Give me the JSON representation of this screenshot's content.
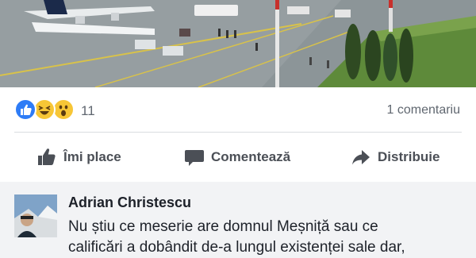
{
  "post": {
    "photo_alt": "airport apron with a turboprop aircraft"
  },
  "reactions": {
    "icons": [
      "like-icon",
      "haha-icon",
      "wow-icon"
    ],
    "count": "11",
    "comments_label": "1 comentariu"
  },
  "actions": {
    "like_label": "Îmi place",
    "comment_label": "Comentează",
    "share_label": "Distribuie"
  },
  "comment": {
    "author": "Adrian Christescu",
    "line1": "Nu știu ce meserie are domnul Meșniță sau ce",
    "line2": "calificări a dobândit de-a lungul existenței sale dar,"
  },
  "colors": {
    "accent": "#2e7cf6",
    "reaction_yellow": "#f7c636",
    "action_gray": "#4b4f56",
    "comment_bg": "#f2f3f5"
  }
}
